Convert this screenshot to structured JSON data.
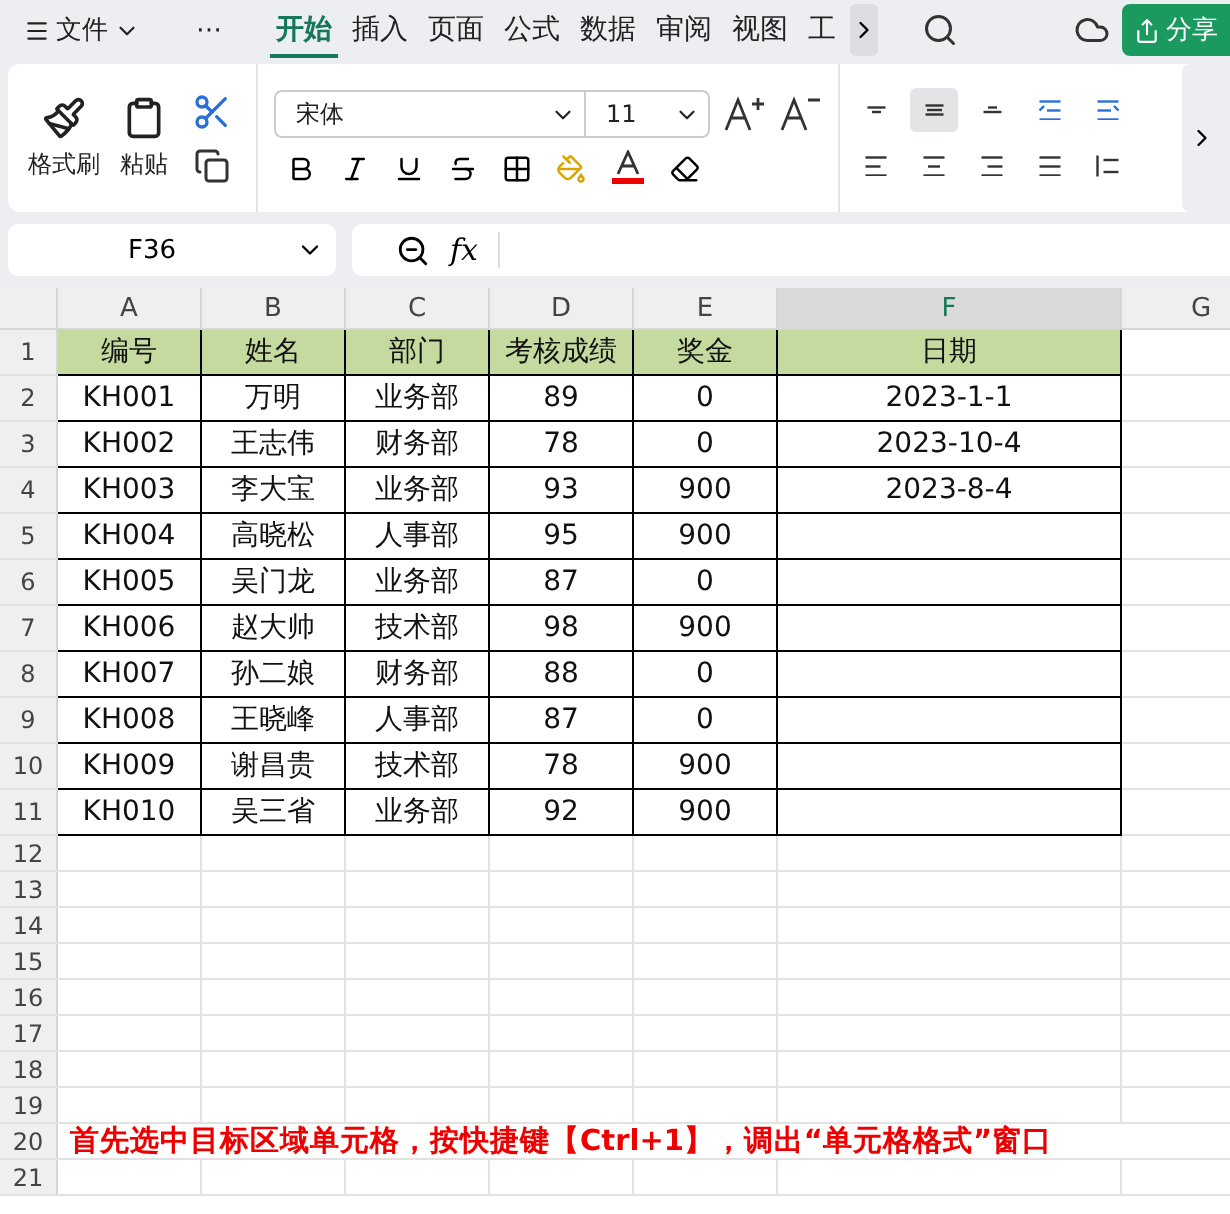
{
  "menu": {
    "file_label": "文件",
    "more": "⋯",
    "tabs": [
      {
        "label": "开始",
        "selected": true
      },
      {
        "label": "插入",
        "selected": false
      },
      {
        "label": "页面",
        "selected": false
      },
      {
        "label": "公式",
        "selected": false
      },
      {
        "label": "数据",
        "selected": false
      },
      {
        "label": "审阅",
        "selected": false
      },
      {
        "label": "视图",
        "selected": false
      },
      {
        "label": "工",
        "selected": false
      }
    ],
    "share_label": "分享"
  },
  "ribbon": {
    "format_painter": "格式刷",
    "paste": "粘贴",
    "font_name": "宋体",
    "font_size": "11",
    "align_buttons": [
      {
        "kind": "top",
        "selected": false
      },
      {
        "kind": "middle",
        "selected": true
      },
      {
        "kind": "bottom",
        "selected": false
      },
      {
        "kind": "outdent",
        "selected": false
      },
      {
        "kind": "indent",
        "selected": false
      },
      {
        "kind": "left",
        "selected": false
      },
      {
        "kind": "center",
        "selected": false
      },
      {
        "kind": "right",
        "selected": false
      },
      {
        "kind": "justify",
        "selected": false
      },
      {
        "kind": "distribute",
        "selected": false
      }
    ]
  },
  "formula_bar": {
    "name_box": "F36",
    "fx": "fx"
  },
  "columns": [
    {
      "label": "A",
      "selected": false
    },
    {
      "label": "B",
      "selected": false
    },
    {
      "label": "C",
      "selected": false
    },
    {
      "label": "D",
      "selected": false
    },
    {
      "label": "E",
      "selected": false
    },
    {
      "label": "F",
      "selected": true
    },
    {
      "label": "G",
      "selected": false
    }
  ],
  "table": {
    "header": [
      "编号",
      "姓名",
      "部门",
      "考核成绩",
      "奖金",
      "日期"
    ],
    "rows": [
      [
        "KH001",
        "万明",
        "业务部",
        "89",
        "0",
        "2023-1-1"
      ],
      [
        "KH002",
        "王志伟",
        "财务部",
        "78",
        "0",
        "2023-10-4"
      ],
      [
        "KH003",
        "李大宝",
        "业务部",
        "93",
        "900",
        "2023-8-4"
      ],
      [
        "KH004",
        "高晓松",
        "人事部",
        "95",
        "900",
        ""
      ],
      [
        "KH005",
        "吴门龙",
        "业务部",
        "87",
        "0",
        ""
      ],
      [
        "KH006",
        "赵大帅",
        "技术部",
        "98",
        "900",
        ""
      ],
      [
        "KH007",
        "孙二娘",
        "财务部",
        "88",
        "0",
        ""
      ],
      [
        "KH008",
        "王晓峰",
        "人事部",
        "87",
        "0",
        ""
      ],
      [
        "KH009",
        "谢昌贵",
        "技术部",
        "78",
        "900",
        ""
      ],
      [
        "KH010",
        "吴三省",
        "业务部",
        "92",
        "900",
        ""
      ]
    ]
  },
  "sheet_rows": [
    {
      "number": "1"
    },
    {
      "number": "2"
    },
    {
      "number": "3"
    },
    {
      "number": "4"
    },
    {
      "number": "5"
    },
    {
      "number": "6"
    },
    {
      "number": "7"
    },
    {
      "number": "8"
    },
    {
      "number": "9"
    },
    {
      "number": "10"
    },
    {
      "number": "11"
    },
    {
      "number": "12"
    },
    {
      "number": "13"
    },
    {
      "number": "14"
    },
    {
      "number": "15"
    },
    {
      "number": "16"
    },
    {
      "number": "17"
    },
    {
      "number": "18"
    },
    {
      "number": "19"
    },
    {
      "number": "20",
      "note": "首先选中目标区域单元格，按快捷键【Ctrl+1】，调出“单元格格式”窗口"
    },
    {
      "number": "21"
    }
  ]
}
